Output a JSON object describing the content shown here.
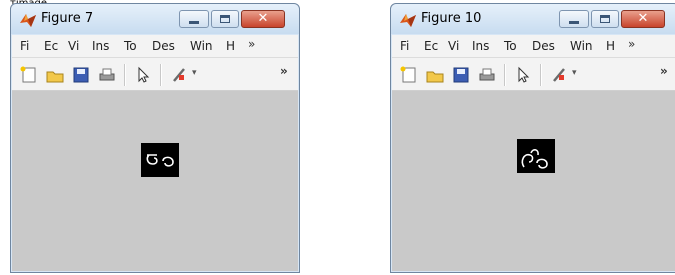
{
  "page": {
    "top_label": "ᴛimage"
  },
  "windows": [
    {
      "title": "Figure 7",
      "icon": "matlab-icon",
      "menu": [
        {
          "label": "Fi",
          "underline": "F"
        },
        {
          "label": "Ec",
          "underline": "E"
        },
        {
          "label": "Vi",
          "underline": "V"
        },
        {
          "label": "Ins",
          "underline": "I"
        },
        {
          "label": "To",
          "underline": "T"
        },
        {
          "label": "Des",
          "underline": "D"
        },
        {
          "label": "Win",
          "underline": "W"
        },
        {
          "label": "H",
          "underline": "H"
        }
      ],
      "menu_overflow": "»",
      "toolbar": {
        "icons": [
          "new-file-icon",
          "open-folder-icon",
          "save-icon",
          "print-icon",
          "pointer-icon",
          "brush-icon"
        ],
        "overflow": "»",
        "dropdown": "▾"
      },
      "canvas": {
        "background": "#c9c9c9",
        "image_note": "black square with white script glyph"
      }
    },
    {
      "title": "Figure 10",
      "icon": "matlab-icon",
      "menu": [
        {
          "label": "Fi",
          "underline": "F"
        },
        {
          "label": "Ec",
          "underline": "E"
        },
        {
          "label": "Vi",
          "underline": "V"
        },
        {
          "label": "Ins",
          "underline": "I"
        },
        {
          "label": "To",
          "underline": "T"
        },
        {
          "label": "Des",
          "underline": "D"
        },
        {
          "label": "Win",
          "underline": "W"
        },
        {
          "label": "H",
          "underline": "H"
        }
      ],
      "menu_overflow": "»",
      "toolbar": {
        "icons": [
          "new-file-icon",
          "open-folder-icon",
          "save-icon",
          "print-icon",
          "pointer-icon",
          "brush-icon"
        ],
        "overflow": "»",
        "dropdown": "▾"
      },
      "canvas": {
        "background": "#c9c9c9",
        "image_note": "black square with white script glyph"
      }
    }
  ],
  "colors": {
    "titlebar": "#d7e6f5",
    "close_button": "#c8442c",
    "menubar": "#f3f3f3",
    "canvas": "#c9c9c9",
    "image_bg": "#000000",
    "glyph": "#ffffff"
  }
}
